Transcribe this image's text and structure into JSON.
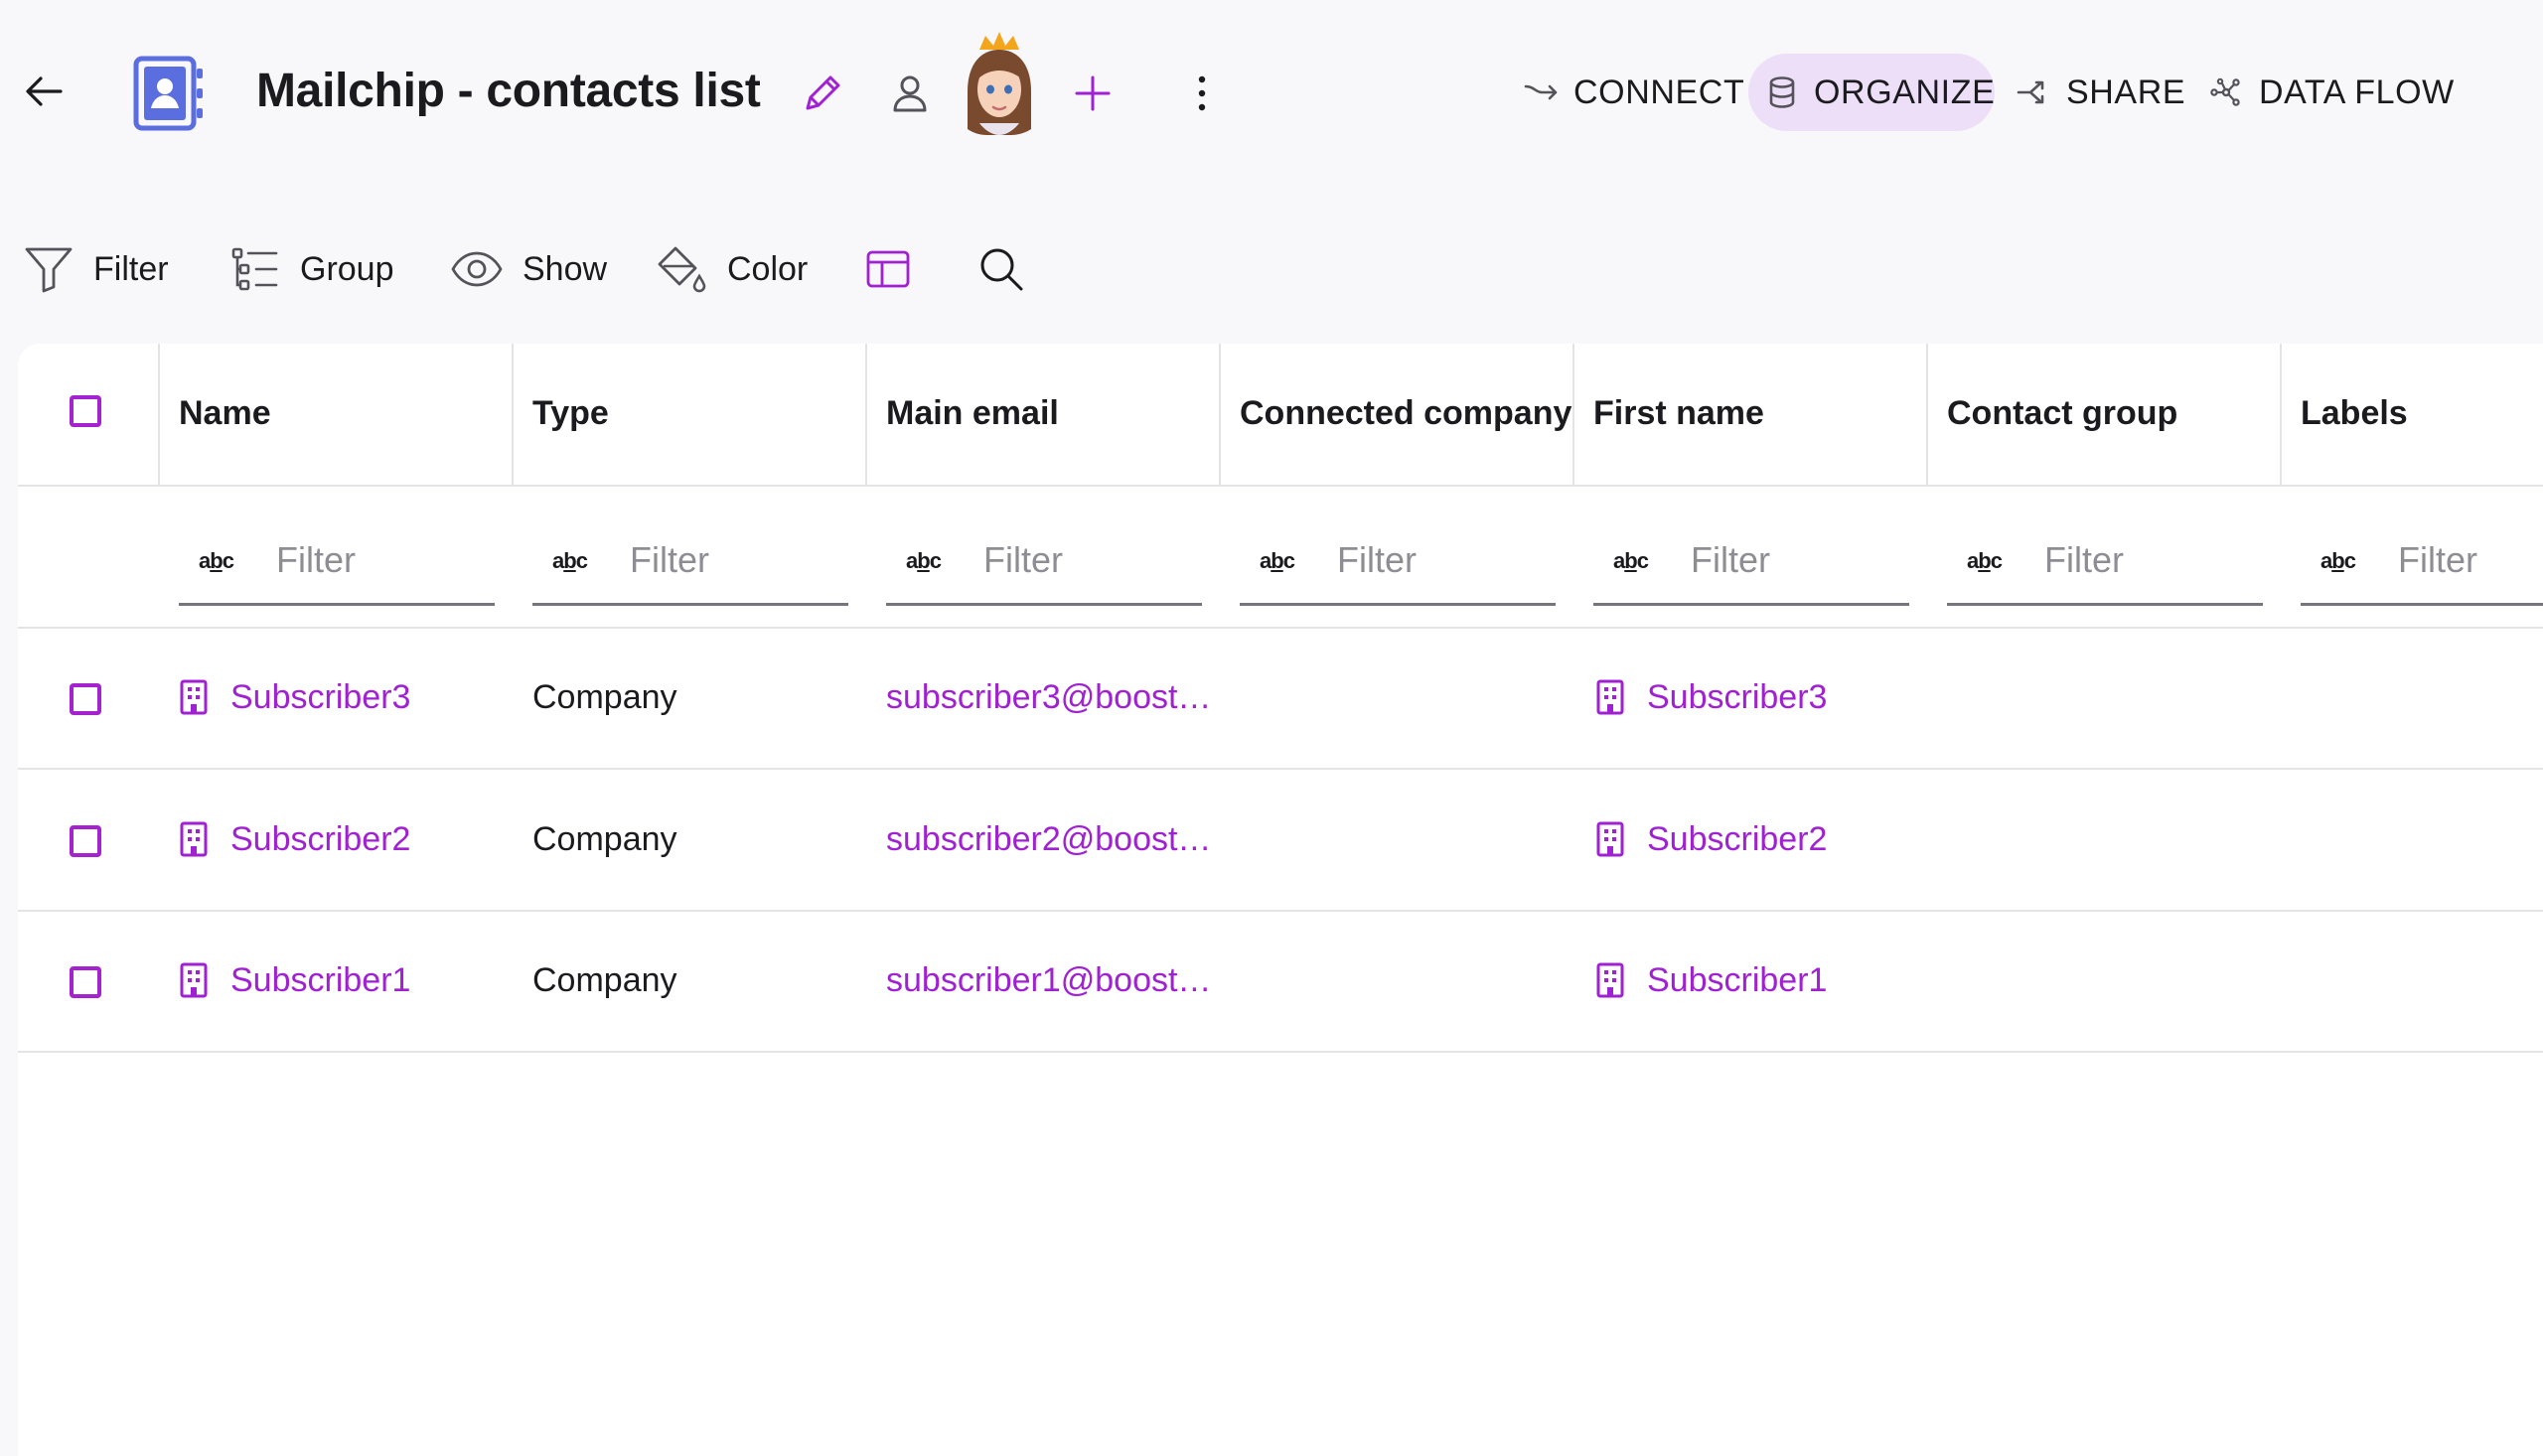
{
  "header": {
    "title": "Mailchip - contacts list",
    "nav": [
      {
        "label": "CONNECT",
        "icon": "connect-arrow-icon"
      },
      {
        "label": "ORGANIZE",
        "icon": "database-icon",
        "active": true
      },
      {
        "label": "SHARE",
        "icon": "share-icon"
      },
      {
        "label": "DATA FLOW",
        "icon": "data-flow-icon"
      }
    ]
  },
  "toolbar": {
    "filter_label": "Filter",
    "group_label": "Group",
    "show_label": "Show",
    "color_label": "Color"
  },
  "table": {
    "columns": [
      "Name",
      "Type",
      "Main email",
      "Connected company",
      "First name",
      "Contact group",
      "Labels"
    ],
    "filter_placeholder": "Filter",
    "type_glyph": "abc",
    "rows": [
      {
        "name": "Subscriber3",
        "type": "Company",
        "email": "subscriber3@boost…",
        "connected_company": "",
        "first_name": "Subscriber3",
        "contact_group": "",
        "labels": ""
      },
      {
        "name": "Subscriber2",
        "type": "Company",
        "email": "subscriber2@boost…",
        "connected_company": "",
        "first_name": "Subscriber2",
        "contact_group": "",
        "labels": ""
      },
      {
        "name": "Subscriber1",
        "type": "Company",
        "email": "subscriber1@boost…",
        "connected_company": "",
        "first_name": "Subscriber1",
        "contact_group": "",
        "labels": ""
      }
    ]
  },
  "colors": {
    "accent": "#a021d2",
    "active_nav_bg": "#eedff8",
    "app_icon": "#5b6ee0",
    "background": "#f8f7f9"
  }
}
